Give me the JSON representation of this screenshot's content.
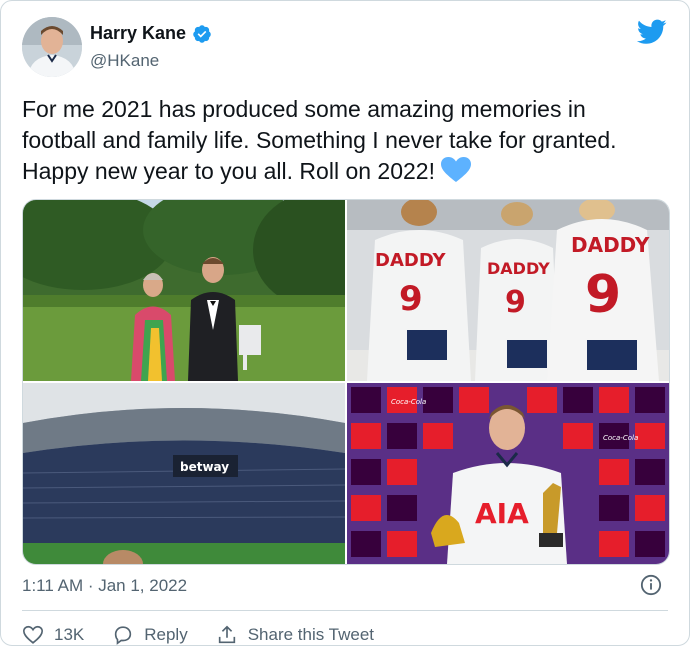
{
  "user": {
    "display_name": "Harry Kane",
    "handle": "@HKane",
    "verified": true
  },
  "tweet": {
    "text": "For me 2021 has produced some amazing memories in football and family life. Something I never take for granted. Happy new year to you all. Roll on 2022!",
    "emoji": "blue-heart",
    "timestamp": "1:11 AM · Jan 1, 2022"
  },
  "media": {
    "photos": [
      {
        "subject": "couple-garden-photo"
      },
      {
        "subject": "kids-daddy-shirts-photo",
        "shirt_text": "DADDY",
        "shirt_number": "9"
      },
      {
        "subject": "stadium-photo",
        "sign": "betway"
      },
      {
        "subject": "golden-boot-photo",
        "shirt_sponsor": "AIA",
        "backdrop_brand": "Coca-Cola"
      }
    ]
  },
  "actions": {
    "like_count": "13K",
    "reply_label": "Reply",
    "share_label": "Share this Tweet"
  },
  "colors": {
    "twitter_blue": "#1d9bf0",
    "text_primary": "#0f1419",
    "text_secondary": "#536471",
    "border": "#cfd9de",
    "heart": "#5db2ff"
  }
}
